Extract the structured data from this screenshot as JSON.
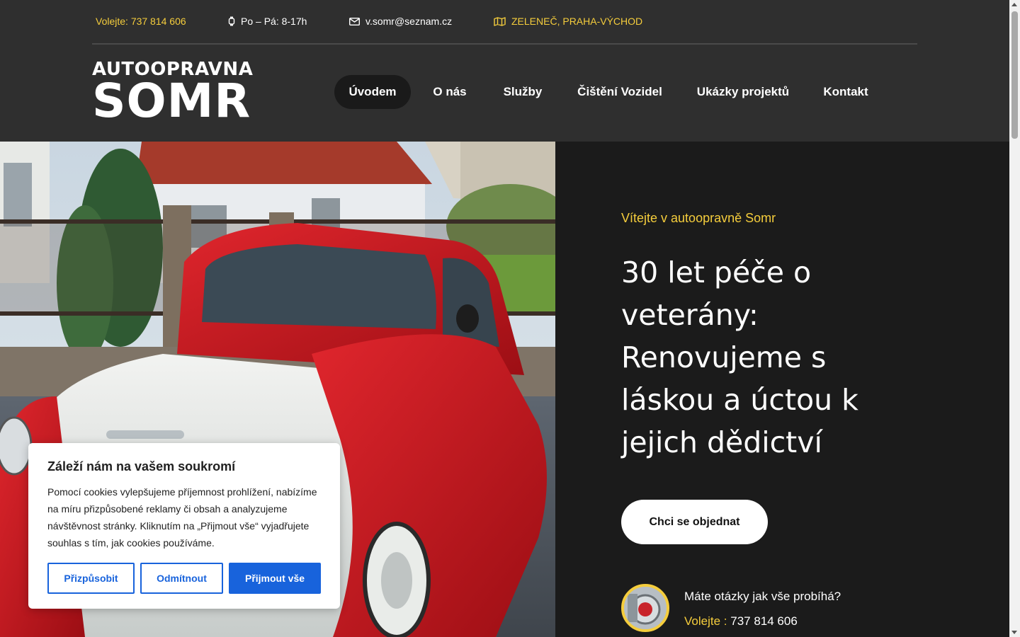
{
  "topbar": {
    "phone": "Volejte: 737 814 606",
    "hours": "Po – Pá: 8-17h",
    "email": "v.somr@seznam.cz",
    "location": "ZELENEČ, PRAHA-VÝCHOD"
  },
  "logo": {
    "line1": "AUTOOPRAVNA",
    "line2": "SOMR"
  },
  "nav": {
    "items": [
      {
        "label": "Úvodem",
        "active": true
      },
      {
        "label": "O nás"
      },
      {
        "label": "Služby"
      },
      {
        "label": "Čištění Vozidel"
      },
      {
        "label": "Ukázky projektů"
      },
      {
        "label": "Kontakt"
      }
    ]
  },
  "hero": {
    "welcome": "Vítejte v autoopravně Somr",
    "headline": "30 let péče o veterány: Renovujeme s láskou a úctou k jejich dědictví",
    "cta": "Chci se objednat",
    "question": "Máte otázky jak vše probíhá?",
    "call_label": "Volejte :",
    "call_number": "737 814 606"
  },
  "cookie": {
    "title": "Záleží nám na vašem soukromí",
    "text": "Pomocí cookies vylepšujeme příjemnost prohlížení, nabízíme na míru přizpůsobené reklamy či obsah a analyzujeme návštěvnost stránky. Kliknutím na „Přijmout vše“ vyjadřujete souhlas s tím, jak cookies používáme.",
    "customize": "Přizpůsobit",
    "reject": "Odmítnout",
    "accept": "Přijmout vše"
  },
  "colors": {
    "accent": "#f5cd3c",
    "header_bg": "#2f2f2f",
    "hero_bg": "#1b1b1b",
    "cookie_blue": "#1863dc"
  }
}
